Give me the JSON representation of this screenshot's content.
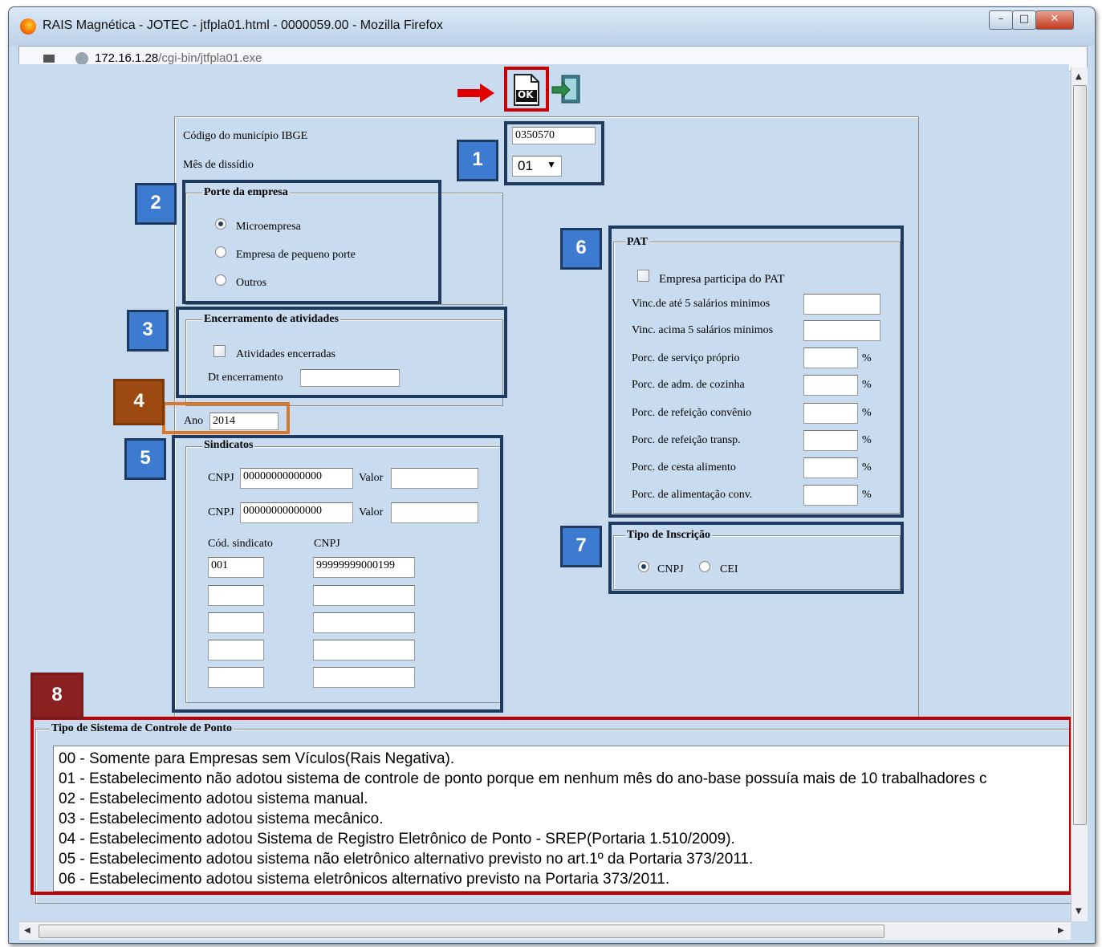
{
  "window": {
    "title": "RAIS Magnética - JOTEC - jtfpla01.html - 0000059.00 - Mozilla Firefox",
    "url_host": "172.16.1.28",
    "url_path": "/cgi-bin/jtfpla01.exe"
  },
  "toolbar": {
    "ok_icon": "OK",
    "exit_icon": "exit-icon"
  },
  "header_fields": {
    "ibge_label": "Código do município IBGE",
    "ibge_value": "0350570",
    "dissidio_label": "Mês de dissídio",
    "dissidio_value": "01"
  },
  "porte": {
    "legend": "Porte da empresa",
    "options": [
      "Microempresa",
      "Empresa de pequeno porte",
      "Outros"
    ],
    "selected": "Microempresa"
  },
  "encerramento": {
    "legend": "Encerramento de atividades",
    "checkbox_label": "Atividades encerradas",
    "date_label": "Dt encerramento",
    "date_value": ""
  },
  "ano": {
    "label": "Ano",
    "value": "2014"
  },
  "sindicatos": {
    "legend": "Sindicatos",
    "cnpj_label": "CNPJ",
    "valor_label": "Valor",
    "rows": [
      {
        "cnpj": "00000000000000",
        "valor": ""
      },
      {
        "cnpj": "00000000000000",
        "valor": ""
      }
    ],
    "cod_header": "Cód. sindicato",
    "cnpj_header": "CNPJ",
    "list": [
      {
        "cod": "001",
        "cnpj": "99999999000199"
      },
      {
        "cod": "",
        "cnpj": ""
      },
      {
        "cod": "",
        "cnpj": ""
      },
      {
        "cod": "",
        "cnpj": ""
      },
      {
        "cod": "",
        "cnpj": ""
      }
    ]
  },
  "pat": {
    "legend": "PAT",
    "checkbox_label": "Empresa participa do PAT",
    "fields": [
      {
        "label": "Vinc.de até 5 salários minimos",
        "value": "",
        "percent": ""
      },
      {
        "label": "Vinc. acima 5 salários minimos",
        "value": "",
        "percent": ""
      },
      {
        "label": "Porc. de serviço próprio",
        "value": "",
        "percent": "%"
      },
      {
        "label": "Porc. de adm. de cozinha",
        "value": "",
        "percent": "%"
      },
      {
        "label": "Porc. de refeição convênio",
        "value": "",
        "percent": "%"
      },
      {
        "label": "Porc. de refeição transp.",
        "value": "",
        "percent": "%"
      },
      {
        "label": "Porc. de cesta alimento",
        "value": "",
        "percent": "%"
      },
      {
        "label": "Porc. de alimentação conv.",
        "value": "",
        "percent": "%"
      }
    ]
  },
  "inscricao": {
    "legend": "Tipo de Inscrição",
    "options": [
      "CNPJ",
      "CEI"
    ],
    "selected": "CNPJ"
  },
  "ponto": {
    "legend": "Tipo de Sistema de Controle de Ponto",
    "options": [
      "00 - Somente para Empresas sem Vículos(Rais Negativa).",
      "01 - Estabelecimento não adotou sistema de controle de ponto porque em nenhum mês do ano-base possuía mais de 10 trabalhadores c",
      "02 - Estabelecimento adotou sistema manual.",
      "03 - Estabelecimento adotou sistema mecânico.",
      "04 - Estabelecimento adotou Sistema de Registro Eletrônico de Ponto - SREP(Portaria 1.510/2009).",
      "05 - Estabelecimento adotou sistema não eletrônico alternativo previsto no art.1º da Portaria 373/2011.",
      "06 - Estabelecimento adotou sistema eletrônicos alternativo previsto na Portaria 373/2011."
    ]
  },
  "annotations": [
    "1",
    "2",
    "3",
    "4",
    "5",
    "6",
    "7",
    "8"
  ],
  "colors": {
    "annotation_blue": "#3c7bd0",
    "annotation_border": "#1e3a5f",
    "annotation_orange": "#9c4a12",
    "annotation_red": "#8b2020",
    "highlight_red": "#cc0000",
    "page_bg": "#c9dbee"
  }
}
